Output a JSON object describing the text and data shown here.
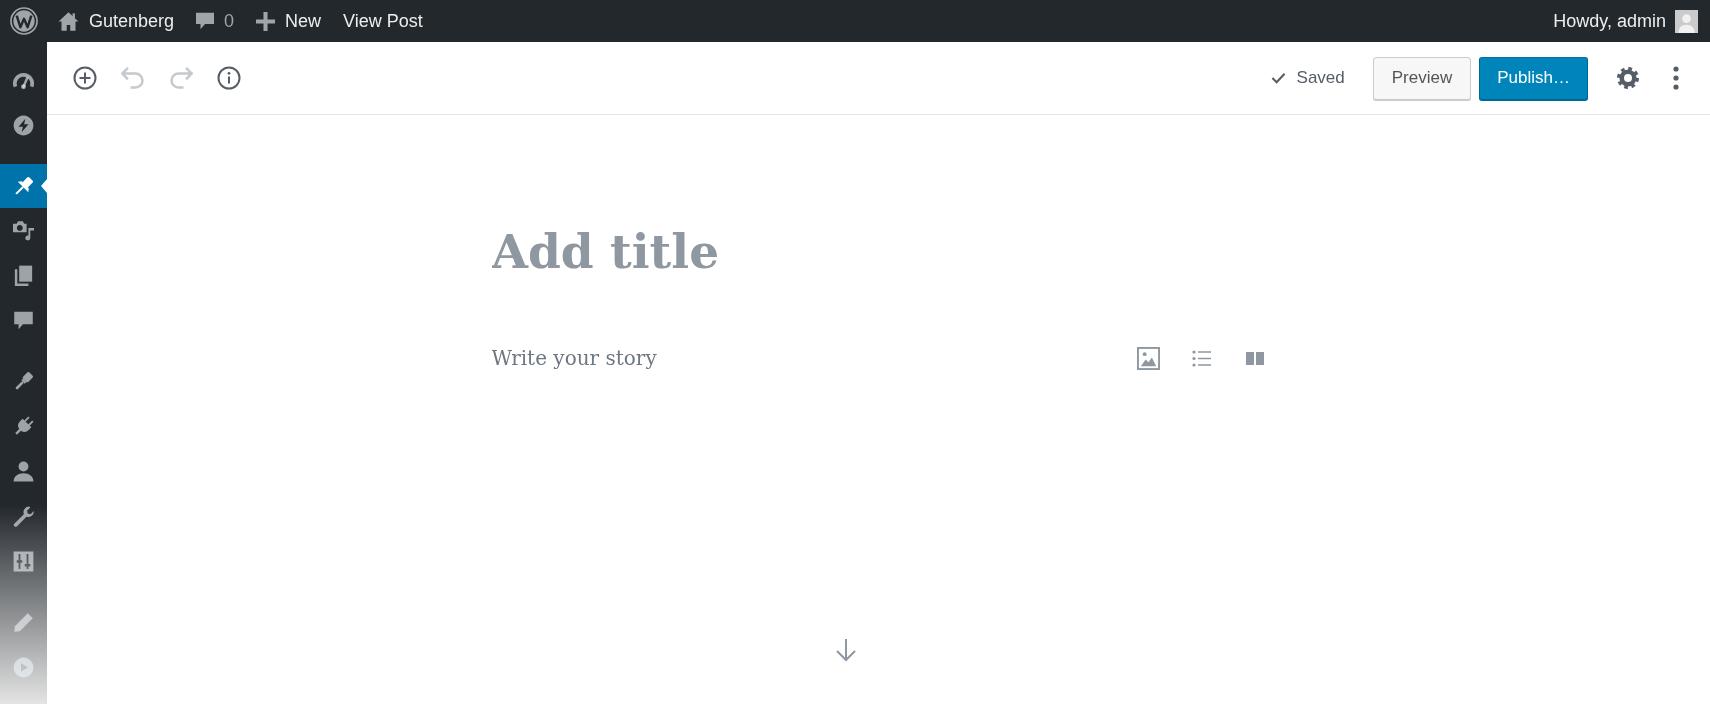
{
  "admin_bar": {
    "site_name": "Gutenberg",
    "comment_count": "0",
    "new_label": "New",
    "view_post_label": "View Post",
    "greeting": "Howdy, admin"
  },
  "sidebar": {
    "groups": [
      {
        "items": [
          {
            "selected": false
          },
          {
            "selected": false
          }
        ]
      },
      {
        "items": [
          {
            "selected": true
          },
          {
            "selected": false
          },
          {
            "selected": false
          },
          {
            "selected": false
          }
        ]
      },
      {
        "items": [
          {
            "selected": false
          },
          {
            "selected": false
          },
          {
            "selected": false
          },
          {
            "selected": false
          },
          {
            "selected": false
          }
        ]
      },
      {
        "items": [
          {
            "selected": false
          },
          {
            "selected": false
          }
        ]
      }
    ]
  },
  "header_toolbar": {
    "tools": [
      {
        "disabled": false
      },
      {
        "disabled": true
      },
      {
        "disabled": true
      },
      {
        "disabled": false
      }
    ],
    "save_status": "Saved",
    "preview_label": "Preview",
    "publish_label": "Publish…"
  },
  "editor": {
    "title": {
      "placeholder": "Add title"
    },
    "body": {
      "placeholder": "Write your story"
    }
  }
}
